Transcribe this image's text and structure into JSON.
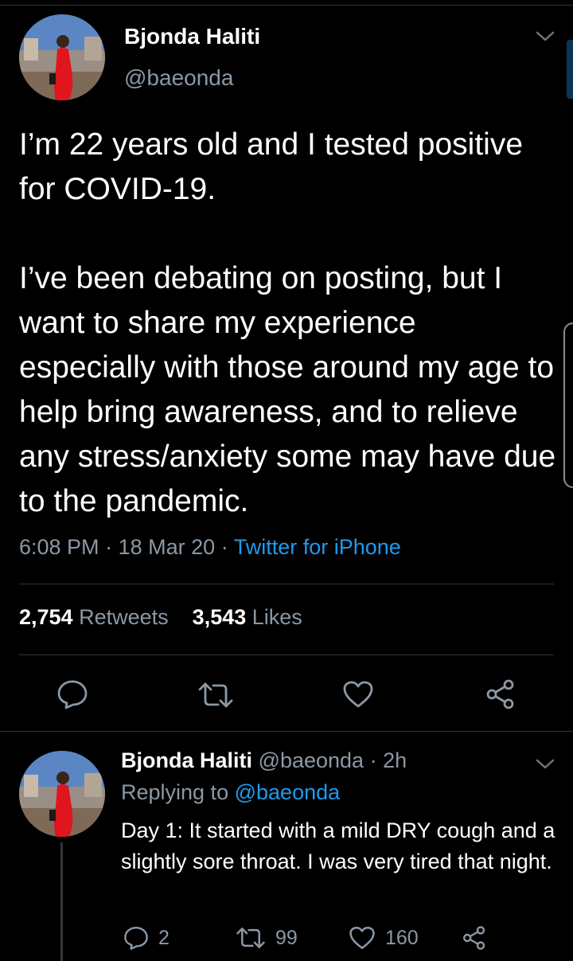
{
  "tweet": {
    "author_name": "Bjonda Haliti",
    "author_handle": "@baeonda",
    "text": "I’m 22 years old and I tested positive for COVID-19.\n\nI’ve been debating on posting, but I want to share my experience especially with those around my age to help bring awareness, and to relieve any stress/anxiety some may have due to the pandemic.",
    "time": "6:08 PM",
    "date": "18 Mar 20",
    "separator": "·",
    "source": "Twitter for iPhone",
    "retweets_count": "2,754",
    "retweets_label": "Retweets",
    "likes_count": "3,543",
    "likes_label": "Likes"
  },
  "reply": {
    "author_name": "Bjonda Haliti",
    "author_handle": "@baeonda",
    "time": "· 2h",
    "replying_prefix": "Replying to",
    "replying_to": "@baeonda",
    "text": "Day 1: It started with a mild DRY cough and a slightly sore throat. I was very tired that night.",
    "reply_count": "2",
    "retweet_count": "99",
    "like_count": "160"
  },
  "icons": {
    "reply": "reply-icon",
    "retweet": "retweet-icon",
    "like": "heart-icon",
    "share": "share-icon",
    "menu": "chevron-down-icon"
  },
  "colors": {
    "background": "#000000",
    "accent": "#1d9bf0",
    "secondary_text": "#8b98a5",
    "divider": "#2f3336"
  }
}
